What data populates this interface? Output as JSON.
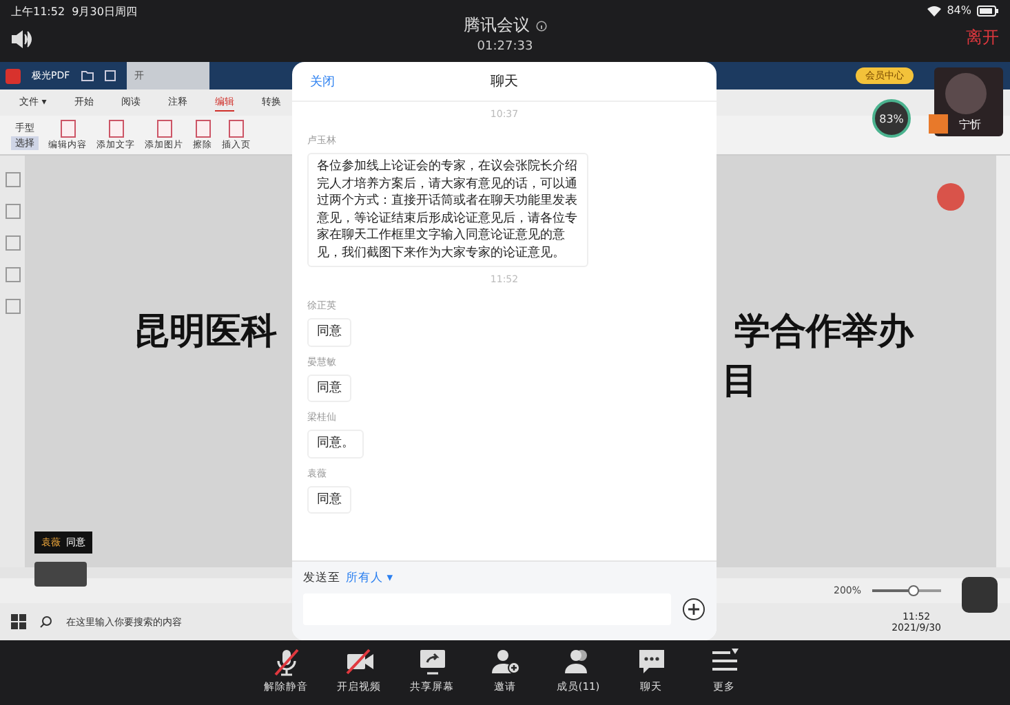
{
  "status_bar": {
    "time": "上午11:52",
    "date": "9月30日周四",
    "battery": "84%"
  },
  "meeting": {
    "title": "腾讯会议",
    "duration": "01:27:33",
    "leave": "离开"
  },
  "shared_screen": {
    "app_name": "极光PDF",
    "home_tab": "开",
    "menu_tabs": [
      {
        "label": "文件 ▾",
        "selected": false
      },
      {
        "label": "开始",
        "selected": false
      },
      {
        "label": "阅读",
        "selected": false
      },
      {
        "label": "注释",
        "selected": false
      },
      {
        "label": "编辑",
        "selected": true
      },
      {
        "label": "转换",
        "selected": false
      }
    ],
    "modes": [
      {
        "label": "手型",
        "selected": false
      },
      {
        "label": "选择",
        "selected": true
      }
    ],
    "tools": [
      "编辑内容",
      "添加文字",
      "添加图片",
      "擦除",
      "插入页"
    ],
    "document_lines": [
      {
        "left": "昆明医科",
        "right": "学合作举办"
      },
      {
        "right": "目"
      }
    ],
    "zoom": "200%",
    "zoom_slider": {
      "level": 0.6
    },
    "taskbar": {
      "search_placeholder": "在这里输入你要搜索的内容",
      "time": "11:52",
      "date": "2021/9/30"
    }
  },
  "video_tile": {
    "name": "宁忻",
    "member_badge": "会员中心",
    "gauge": "83%"
  },
  "notification": {
    "sender": "袁薇",
    "text": "同意"
  },
  "chat": {
    "close": "关闭",
    "title": "聊天",
    "items": [
      {
        "kind": "time",
        "text": "10:37"
      },
      {
        "kind": "message",
        "sender": "卢玉林",
        "text": "各位参加线上论证会的专家，在议会张院长介绍完人才培养方案后，请大家有意见的话，可以通过两个方式：直接开话筒或者在聊天功能里发表意见，等论证结束后形成论证意见后，请各位专家在聊天工作框里文字输入同意论证意见的意见，我们截图下来作为大家专家的论证意见。"
      },
      {
        "kind": "time",
        "text": "11:52"
      },
      {
        "kind": "message",
        "sender": "徐正英",
        "text": "同意"
      },
      {
        "kind": "message",
        "sender": "晏慧敏",
        "text": "同意"
      },
      {
        "kind": "message",
        "sender": "梁桂仙",
        "text": "同意。"
      },
      {
        "kind": "message",
        "sender": "袁薇",
        "text": "同意"
      }
    ],
    "send_to_label": "发送至",
    "recipient": "所有人 ▾"
  },
  "toolbar": [
    {
      "kind": "mic-off",
      "label": "解除静音"
    },
    {
      "kind": "video-off",
      "label": "开启视频"
    },
    {
      "kind": "share",
      "label": "共享屏幕"
    },
    {
      "kind": "invite",
      "label": "邀请"
    },
    {
      "kind": "members",
      "label": "成员(11)"
    },
    {
      "kind": "chat",
      "label": "聊天"
    },
    {
      "kind": "more",
      "label": "更多"
    }
  ]
}
